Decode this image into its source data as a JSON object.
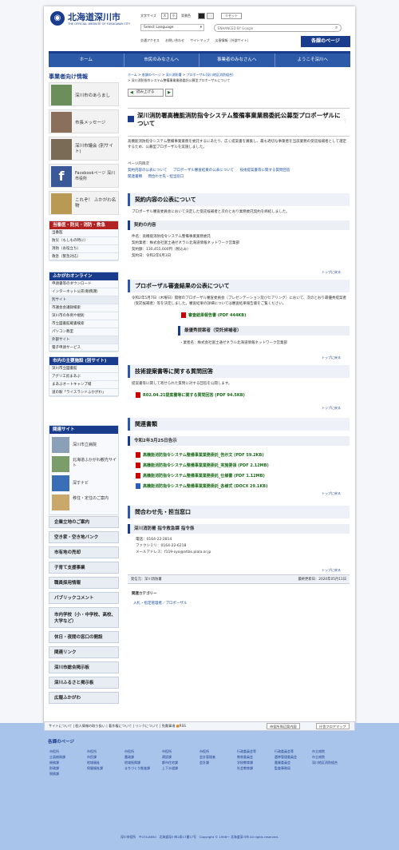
{
  "header": {
    "title": "北海道深川市",
    "subtitle": "THE OFFICIAL WEBSITE OF FUKAGAWA CITY",
    "text_size_label": "文字サイズ",
    "size_large": "大",
    "size_small": "小",
    "color_label": "背景色",
    "reset": "リセット",
    "search_placeholder": "ENHANCED BY Google",
    "language": "Select Language",
    "links": [
      "交通アクセス",
      "お問い合わせ",
      "サイトマップ",
      "災害情報（外部サイト）"
    ],
    "mypage": "各課のページ"
  },
  "nav": [
    "ホーム",
    "市民のみなさんへ",
    "事業者のみなさんへ",
    "ようこそ深川へ"
  ],
  "sidebar": {
    "business_title": "事業者向け情報",
    "feature_links": [
      "深川市のあらまし",
      "市長メッセージ",
      "深川市議会 (別サイト)",
      "Facebookページ 深川市役所",
      "これぞ！ ふかがわ名物"
    ],
    "emergency_title": "当番医・防災・消防・救急",
    "emergency_items": [
      "当番医",
      "防災（もしもの時に）",
      "消防（お役立ち）",
      "救急（緊急対応）"
    ],
    "online_title": "ふかがわオンライン",
    "online_items": [
      "申請書等のダウンロード",
      "インターネット公売(税務課)",
      "別サイト",
      "市議会会議録検索",
      "深川市の条例や規則",
      "市立図書館蔵書検索",
      "パソコン教室",
      "外部サイト",
      "電子申請サービス"
    ],
    "facility_title": "市内の主要施設 (別サイト)",
    "facility_items": [
      "深川市立図書館",
      "アグリ工房まあぶ",
      "まあぶオートキャンプ場",
      "道の駅「ライスランドふかがわ」"
    ],
    "related_title": "関連サイト",
    "related_items": [
      "深川市立病院",
      "北海道ふかがわ観光サイト",
      "深すナビ",
      "移住・定住のご案内"
    ],
    "menu": [
      "企業立地のご案内",
      "空き家・空き地バンク",
      "市有地の売却",
      "子育て支援事業",
      "職員採用情報",
      "パブリックコメント",
      "市内学校（小・中学校、高校、大学など）",
      "休日・夜間の窓口の開設",
      "関連リンク",
      "深川市総合掲示板",
      "深川ふるさと掲示板",
      "広報ふかがわ"
    ]
  },
  "breadcrumb": {
    "items": [
      "ホーム",
      "各課のページ",
      "深川消防署",
      "プロポーザル(深川地区消防組合)"
    ],
    "current": "深川消防指令システム整備事業業務委託公募型プロポーザルについて"
  },
  "readaloud": "読み上げる",
  "page": {
    "title": "深川消防署高機能消防指令システム整備事業業務委託公募型プロポーザルについて",
    "intro": "高機能消防指令システム整備事業業務を委託するにあたり、広く提案書を募集し、最も適切な事業者を当該業務の受託候補者として選定するため、公募型プロポーザルを実施しました。",
    "toc_title": "ページ内目次",
    "toc": [
      "契約内容の公表について",
      "プロポーザル審査結果の公表について",
      "技術提案書等に関する質問回答",
      "関連書類",
      "問合わせ先・担当窓口"
    ]
  },
  "contract": {
    "heading": "契約内容の公表について",
    "text": "プロポーザル審査委員会において決定した受託候補者と次のとおり業務委託契約を締結しました。",
    "sub": "契約の内容",
    "lines": [
      "件名：高機能消防指令システム整備事業業務委託",
      "契約業者：株式会社富士通ゼネラル北海道情報ネットワーク営業部",
      "契約額：130,455,600円（税込み）",
      "契約日：令和2年6月3日"
    ]
  },
  "back_to_top": "トップに戻る",
  "result": {
    "heading": "プロポーザル審査結果の公表について",
    "text": "令和2年5月7日（木曜日）開催のプロポーザル審査委員会（プレゼンテーション及びヒアリング）において、次のとおり最優秀提案者（受託候補者）等を決定しました。審査結果の詳細については審査結果報告書をご覧ください。",
    "file": "審査結果報告書 (PDF 444KB)",
    "sub": "最優秀提案者（受託候補者）",
    "winner": "・業者名：株式会社富士通ゼネラル北海道情報ネットワーク営業部"
  },
  "qa": {
    "heading": "技術提案書等に関する質問回答",
    "text": "提案書等に関して寄せられた質問に対する回答を公開します。",
    "file": "R02.04.21提案書等に関する質問回答 (PDF 94.5KB)"
  },
  "docs": {
    "heading": "関連書類",
    "sub": "令和2年3月25日告示",
    "files": [
      "高機能消防指令システム整備事業業務委託_告示文 (PDF 59.2KB)",
      "高機能消防指令システム整備事業業務委託_実施要領 (PDF 2.12MB)",
      "高機能消防指令システム整備事業業務委託_仕様書 (PDF 1.12MB)",
      "高機能消防指令システム整備事業業務委託_各様式 (DOCX 29.1KB)"
    ]
  },
  "contact": {
    "heading": "問合わせ先・担当窓口",
    "sub": "深川消防署 指令救急課 指令係",
    "tel": "電話：0164-22-2814",
    "fax": "ファクシミリ：0164-22-6218",
    "mail": "メールアドレス：f119-syo@atlas.plala.or.jp"
  },
  "meta": {
    "source": "発信元：深川消防署",
    "updated": "最終更新日：2020年05月11日"
  },
  "category": {
    "label": "関連カテゴリー",
    "item": "入札・指定管理者／プロポーザル"
  },
  "footer": {
    "links": [
      "サイトについて",
      "個人情報の取り扱い",
      "著作権について",
      "リンクについて",
      "免責事項",
      "RSS"
    ],
    "map": "市役所周辺案内図",
    "floor": "庁舎フロアマップ",
    "dept_title": "各課のページ",
    "depts": [
      [
        "市役所",
        "企画総務課",
        "総務課",
        "財政課",
        "税務課"
      ],
      [
        "市役所",
        "市民課",
        "地域福祉",
        "保健福祉課"
      ],
      [
        "市役所",
        "農政課",
        "地域振興課",
        "まちづくり推進課"
      ],
      [
        "市役所",
        "建設課",
        "都市住宅課",
        "上下水道課"
      ],
      [
        "市役所",
        "会計管理者",
        "会計課"
      ],
      [
        "行政委員会等",
        "教育委員会",
        "学校教育課",
        "社会教育課"
      ],
      [
        "行政委員会等",
        "選挙管理委員会",
        "農業委員会",
        "監査事務局"
      ],
      [
        "市立病院",
        "市立病院",
        "深川地区消防組合"
      ]
    ],
    "copyright": "深川市役所　〒074-8650　北海道深川市2条17番17号　Copyright © 1996〜 北海道深川市 All rights reserved."
  },
  "colors": {
    "primary": "#1a3c8c",
    "nav": "#2d5aa8",
    "emergency": "#b22222",
    "pdf_link": "#1a6a1a"
  }
}
